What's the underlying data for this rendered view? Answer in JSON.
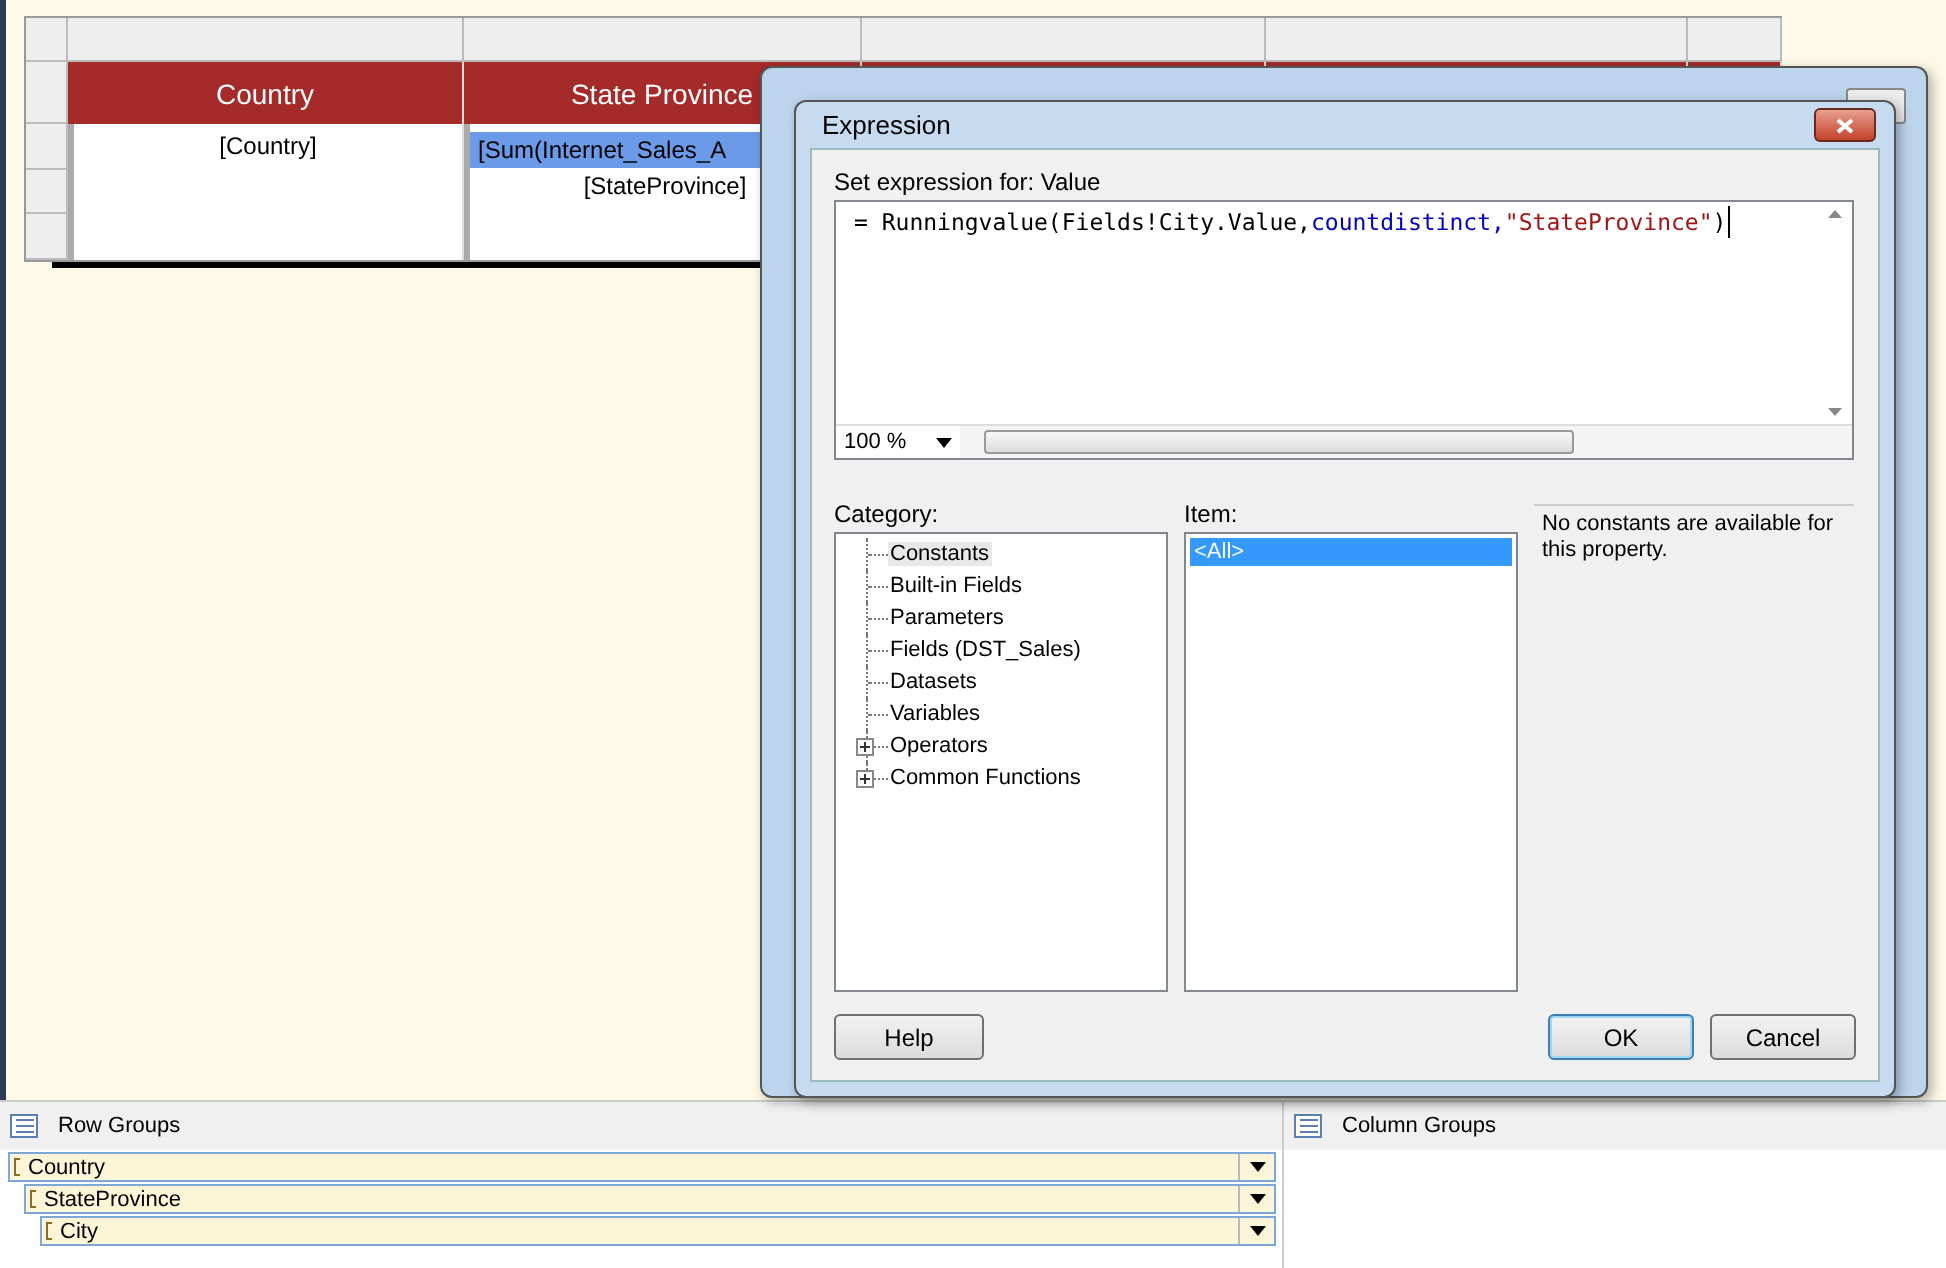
{
  "tablix": {
    "columns": [
      "Country",
      "State Province"
    ],
    "country_cell": "[Country]",
    "state_placeholders": [
      {
        "text": "[Sum(Internet_Sales_A",
        "selected": true
      },
      {
        "text": "[StateProvince]",
        "selected": false
      }
    ]
  },
  "expression_dialog": {
    "title": "Expression",
    "label": "Set expression for: Value",
    "expression": [
      {
        "text": "= Runningvalue(Fields!City.Value,",
        "kind": "plain"
      },
      {
        "text": "countdistinct,",
        "kind": "keyword"
      },
      {
        "text": "\"StateProvince\"",
        "kind": "string"
      },
      {
        "text": ")",
        "kind": "plain"
      }
    ],
    "zoom": "100 %",
    "category_label": "Category:",
    "categories": [
      {
        "label": "Constants",
        "selected": true,
        "expandable": false
      },
      {
        "label": "Built-in Fields",
        "selected": false,
        "expandable": false
      },
      {
        "label": "Parameters",
        "selected": false,
        "expandable": false
      },
      {
        "label": "Fields (DST_Sales)",
        "selected": false,
        "expandable": false
      },
      {
        "label": "Datasets",
        "selected": false,
        "expandable": false
      },
      {
        "label": "Variables",
        "selected": false,
        "expandable": false
      },
      {
        "label": "Operators",
        "selected": false,
        "expandable": true
      },
      {
        "label": "Common Functions",
        "selected": false,
        "expandable": true
      }
    ],
    "item_label": "Item:",
    "items": [
      {
        "label": "<All>",
        "selected": true
      }
    ],
    "description": "No constants are available for this property.",
    "buttons": [
      {
        "label": "Help",
        "default": false
      },
      {
        "label": "OK",
        "default": true
      },
      {
        "label": "Cancel",
        "default": false
      }
    ]
  },
  "row_groups": {
    "title": "Row Groups",
    "groups": [
      {
        "name": "Country",
        "children": [
          {
            "name": "StateProvince",
            "children": [
              {
                "name": "City"
              }
            ]
          }
        ]
      }
    ]
  },
  "column_groups": {
    "title": "Column Groups"
  }
}
